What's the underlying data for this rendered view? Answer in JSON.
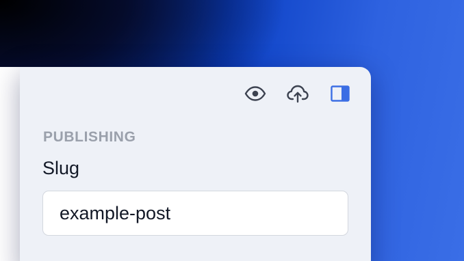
{
  "toolbar": {
    "icons": [
      "eye-icon",
      "cloud-upload-icon",
      "sidebar-toggle-icon"
    ]
  },
  "colors": {
    "icon_default": "#3c4250",
    "icon_active": "#3b6ee4",
    "panel_bg": "#eef1f7"
  },
  "publishing": {
    "section_title": "PUBLISHING",
    "slug_label": "Slug",
    "slug_value": "example-post"
  }
}
